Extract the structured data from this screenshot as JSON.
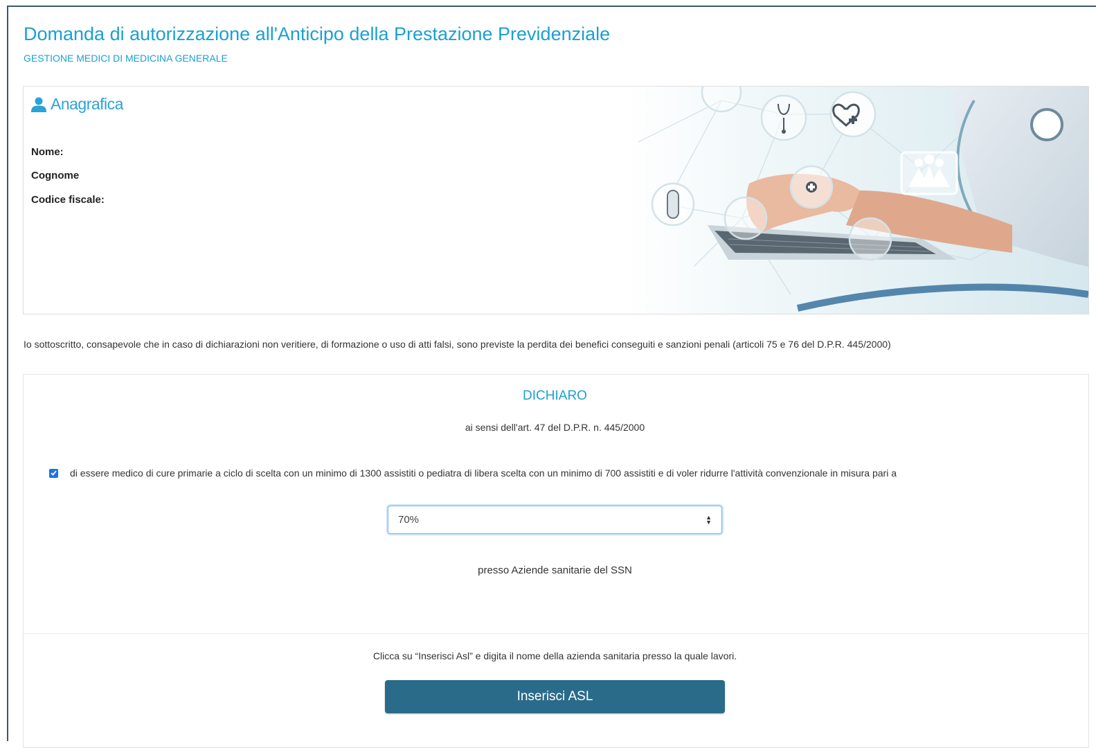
{
  "header": {
    "title": "Domanda di autorizzazione all'Anticipo della Prestazione Previdenziale",
    "subtitle": "GESTIONE MEDICI DI MEDICINA GENERALE"
  },
  "anagrafica": {
    "heading": "Anagrafica",
    "icon": "user-icon",
    "fields": [
      {
        "label": "Nome:"
      },
      {
        "label": "Cognome"
      },
      {
        "label": "Codice fiscale:"
      }
    ]
  },
  "intro": "Io sottoscritto, consapevole che in caso di dichiarazioni non veritiere, di formazione o uso di atti falsi, sono previste la perdita dei benefici conseguiti e sanzioni penali (articoli 75 e 76 del D.P.R. 445/2000)",
  "dichiaro": {
    "title": "DICHIARO",
    "subtitle": "ai sensi dell'art. 47 del D.P.R. n. 445/2000",
    "checkbox_checked": true,
    "checkbox_label": "di essere medico di cure primarie a ciclo di scelta con un minimo di 1300 assistiti o pediatra di libera scelta con un minimo di 700 assistiti e di voler ridurre l'attività convenzionale in misura pari a",
    "select_value": "70%",
    "presso_text": "presso Aziende sanitarie del SSN",
    "hint": "Clicca su “Inserisci Asl” e digita il nome della azienda sanitaria presso la quale lavori.",
    "button_label": "Inserisci ASL"
  },
  "colors": {
    "accent": "#1ba0d2",
    "button": "#2b6b8a",
    "checkbox": "#1a73e8"
  }
}
